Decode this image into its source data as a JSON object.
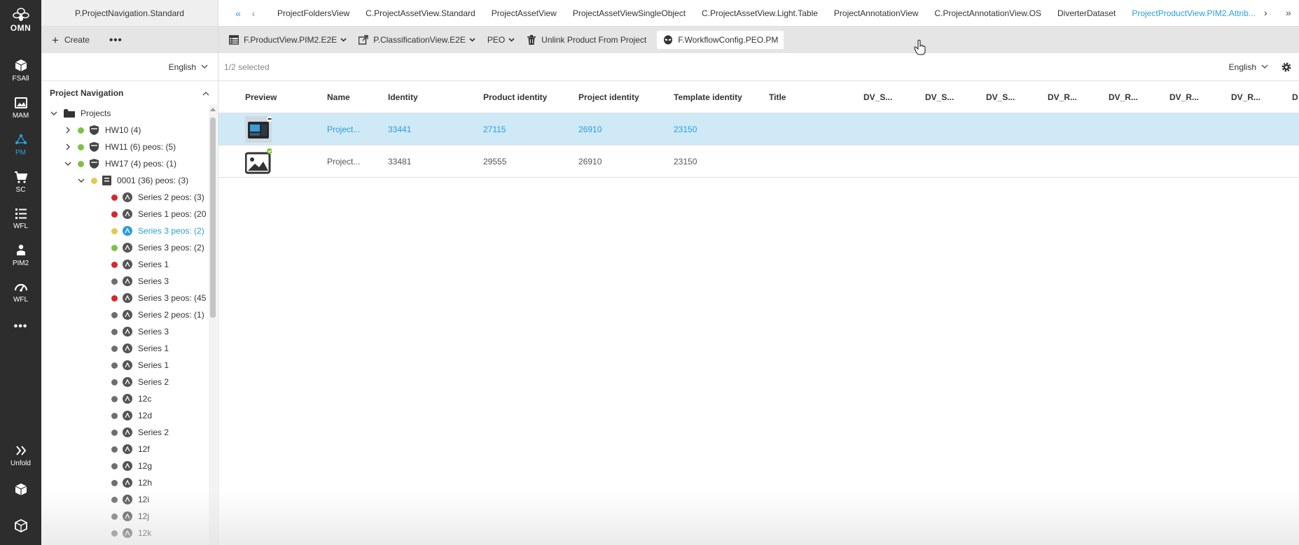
{
  "rail": {
    "logo_text": "OMN",
    "items": [
      {
        "label": "FSAll",
        "icon": "cube-icon"
      },
      {
        "label": "MAM",
        "icon": "image-gallery-icon"
      },
      {
        "label": "PM",
        "icon": "network-icon"
      },
      {
        "label": "SC",
        "icon": "cart-icon"
      },
      {
        "label": "WFL",
        "icon": "list-icon"
      },
      {
        "label": "PIM2",
        "icon": "hand-icon"
      },
      {
        "label": "WFL",
        "icon": "gauge-icon"
      }
    ],
    "more": "•••",
    "unfold_label": "Unfold"
  },
  "nav": {
    "title": "P.ProjectNavigation.Standard",
    "create_label": "Create",
    "more_label": "•••",
    "language": "English",
    "panel_title": "Project Navigation",
    "tree": [
      {
        "label": "Projects"
      },
      {
        "label": "HW10 (4)"
      },
      {
        "label": "HW11 (6) peos: (5)"
      },
      {
        "label": "HW17 (4) peos: (1)"
      },
      {
        "label": "0001 (36) peos: (3)"
      },
      {
        "label": "Series 2 peos: (3)"
      },
      {
        "label": "Series 1 peos: (20"
      },
      {
        "label": "Series 3 peos: (2)"
      },
      {
        "label": "Series 3 peos: (2)"
      },
      {
        "label": "Series 1"
      },
      {
        "label": "Series 3"
      },
      {
        "label": "Series 3 peos: (45"
      },
      {
        "label": "Series 2 peos: (1)"
      },
      {
        "label": "Series 3"
      },
      {
        "label": "Series 1"
      },
      {
        "label": "Series 1"
      },
      {
        "label": "Series 2"
      },
      {
        "label": "12c"
      },
      {
        "label": "12d"
      },
      {
        "label": "Series 2"
      },
      {
        "label": "12f"
      },
      {
        "label": "12g"
      },
      {
        "label": "12h"
      },
      {
        "label": "12i"
      },
      {
        "label": "12j"
      },
      {
        "label": "12k"
      }
    ]
  },
  "tabs": [
    "ProjectFoldersView",
    "C.ProjectAssetView.Standard",
    "ProjectAssetView",
    "ProjectAssetViewSingleObject",
    "C.ProjectAssetView.Light.Table",
    "ProjectAnnotationView",
    "C.ProjectAnnotationView.OS",
    "DiverterDataset",
    "ProjectProductView.PIM2.Attrib..."
  ],
  "toolbar": {
    "product_view": "F.ProductView.PIM2.E2E",
    "classification_view": "P.ClassificationView.E2E",
    "peo": "PEO",
    "unlink": "Unlink Product From Project",
    "workflow": "F.WorkflowConfig.PEO.PM"
  },
  "selection": {
    "text": "1/2 selected",
    "language": "English"
  },
  "grid": {
    "columns": [
      "Preview",
      "Name",
      "Identity",
      "Product identity",
      "Project identity",
      "Template identity",
      "Title",
      "DV_S...",
      "DV_S...",
      "DV_S...",
      "DV_R...",
      "DV_R...",
      "DV_R...",
      "DV_R...",
      "D"
    ],
    "rows": [
      {
        "name": "Project...",
        "identity": "33441",
        "product_identity": "27115",
        "project_identity": "26910",
        "template_identity": "23150"
      },
      {
        "name": "Project...",
        "identity": "33481",
        "product_identity": "29555",
        "project_identity": "26910",
        "template_identity": "23150"
      }
    ]
  },
  "colors": {
    "accent": "#2b9edb",
    "rail_bg": "#2d2d2d",
    "selected_row_bg": "#cfe9f6",
    "status_green": "#7cc242",
    "status_yellow": "#e6c84d",
    "status_red": "#d9262b"
  }
}
